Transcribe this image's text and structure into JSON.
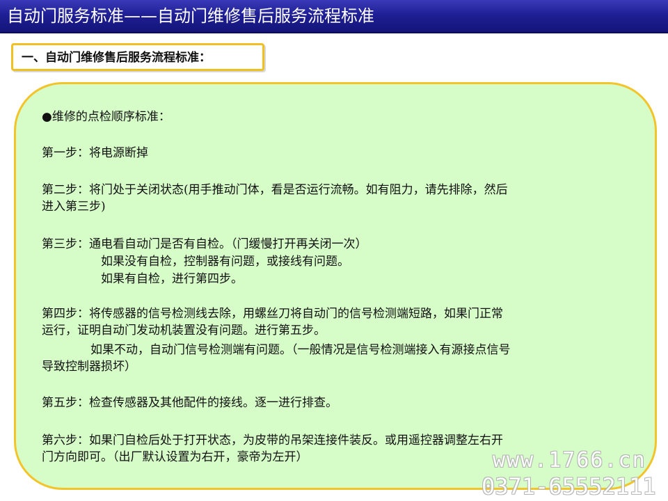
{
  "header": {
    "title": "自动门服务标准——自动门维修售后服务流程标准"
  },
  "section": {
    "heading": "一、自动门维修售后服务流程标准："
  },
  "content": {
    "lines": [
      "●维修的点检顺序标准：",
      "第一步：将电源断掉",
      "第二步：将门处于关闭状态(用手推动门体，看是否运行流畅。如有阻力，请先排除，然后",
      "进入第三步)",
      "第三步：通电看自动门是否有自检。（门缓慢打开再关闭一次）",
      "如果没有自检，控制器有问题，或接线有问题。",
      "如果有自检，进行第四步。",
      "第四步：将传感器的信号检测线去除，用螺丝刀将自动门的信号检测端短路，如果门正常",
      "运行，证明自动门发动机装置没有问题。进行第五步。",
      "如果不动，自动门信号检测端有问题。（一般情况是信号检测端接入有源接点信号",
      "导致控制器损坏）",
      "第五步：检查传感器及其他配件的接线。逐一进行排查。",
      "第六步：如果门自检后处于打开状态，为皮带的吊架连接件装反。或用遥控器调整左右开",
      "门方向即可。（出厂默认设置为右开，豪帝为左开）"
    ]
  },
  "watermark": {
    "url": "www.1766.cn",
    "phone": "0371-65552111"
  },
  "colors": {
    "title_bar": "#1f1f96",
    "box_border": "#f2c42a",
    "content_bg": "#d6fcc8"
  }
}
